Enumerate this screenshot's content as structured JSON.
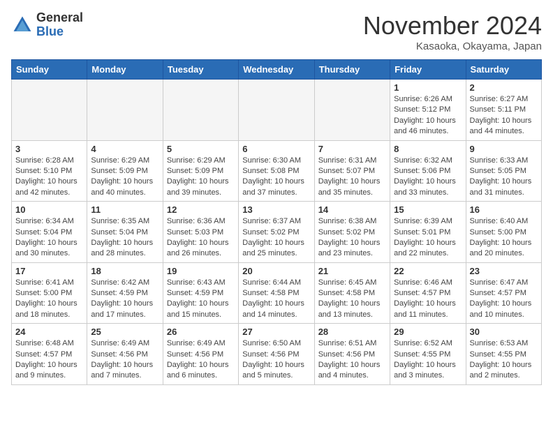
{
  "header": {
    "logo_general": "General",
    "logo_blue": "Blue",
    "month_title": "November 2024",
    "location": "Kasaoka, Okayama, Japan"
  },
  "days_of_week": [
    "Sunday",
    "Monday",
    "Tuesday",
    "Wednesday",
    "Thursday",
    "Friday",
    "Saturday"
  ],
  "weeks": [
    [
      {
        "day": "",
        "empty": true
      },
      {
        "day": "",
        "empty": true
      },
      {
        "day": "",
        "empty": true
      },
      {
        "day": "",
        "empty": true
      },
      {
        "day": "",
        "empty": true
      },
      {
        "day": "1",
        "sunrise": "6:26 AM",
        "sunset": "5:12 PM",
        "daylight": "10 hours and 46 minutes."
      },
      {
        "day": "2",
        "sunrise": "6:27 AM",
        "sunset": "5:11 PM",
        "daylight": "10 hours and 44 minutes."
      }
    ],
    [
      {
        "day": "3",
        "sunrise": "6:28 AM",
        "sunset": "5:10 PM",
        "daylight": "10 hours and 42 minutes."
      },
      {
        "day": "4",
        "sunrise": "6:29 AM",
        "sunset": "5:09 PM",
        "daylight": "10 hours and 40 minutes."
      },
      {
        "day": "5",
        "sunrise": "6:29 AM",
        "sunset": "5:09 PM",
        "daylight": "10 hours and 39 minutes."
      },
      {
        "day": "6",
        "sunrise": "6:30 AM",
        "sunset": "5:08 PM",
        "daylight": "10 hours and 37 minutes."
      },
      {
        "day": "7",
        "sunrise": "6:31 AM",
        "sunset": "5:07 PM",
        "daylight": "10 hours and 35 minutes."
      },
      {
        "day": "8",
        "sunrise": "6:32 AM",
        "sunset": "5:06 PM",
        "daylight": "10 hours and 33 minutes."
      },
      {
        "day": "9",
        "sunrise": "6:33 AM",
        "sunset": "5:05 PM",
        "daylight": "10 hours and 31 minutes."
      }
    ],
    [
      {
        "day": "10",
        "sunrise": "6:34 AM",
        "sunset": "5:04 PM",
        "daylight": "10 hours and 30 minutes."
      },
      {
        "day": "11",
        "sunrise": "6:35 AM",
        "sunset": "5:04 PM",
        "daylight": "10 hours and 28 minutes."
      },
      {
        "day": "12",
        "sunrise": "6:36 AM",
        "sunset": "5:03 PM",
        "daylight": "10 hours and 26 minutes."
      },
      {
        "day": "13",
        "sunrise": "6:37 AM",
        "sunset": "5:02 PM",
        "daylight": "10 hours and 25 minutes."
      },
      {
        "day": "14",
        "sunrise": "6:38 AM",
        "sunset": "5:02 PM",
        "daylight": "10 hours and 23 minutes."
      },
      {
        "day": "15",
        "sunrise": "6:39 AM",
        "sunset": "5:01 PM",
        "daylight": "10 hours and 22 minutes."
      },
      {
        "day": "16",
        "sunrise": "6:40 AM",
        "sunset": "5:00 PM",
        "daylight": "10 hours and 20 minutes."
      }
    ],
    [
      {
        "day": "17",
        "sunrise": "6:41 AM",
        "sunset": "5:00 PM",
        "daylight": "10 hours and 18 minutes."
      },
      {
        "day": "18",
        "sunrise": "6:42 AM",
        "sunset": "4:59 PM",
        "daylight": "10 hours and 17 minutes."
      },
      {
        "day": "19",
        "sunrise": "6:43 AM",
        "sunset": "4:59 PM",
        "daylight": "10 hours and 15 minutes."
      },
      {
        "day": "20",
        "sunrise": "6:44 AM",
        "sunset": "4:58 PM",
        "daylight": "10 hours and 14 minutes."
      },
      {
        "day": "21",
        "sunrise": "6:45 AM",
        "sunset": "4:58 PM",
        "daylight": "10 hours and 13 minutes."
      },
      {
        "day": "22",
        "sunrise": "6:46 AM",
        "sunset": "4:57 PM",
        "daylight": "10 hours and 11 minutes."
      },
      {
        "day": "23",
        "sunrise": "6:47 AM",
        "sunset": "4:57 PM",
        "daylight": "10 hours and 10 minutes."
      }
    ],
    [
      {
        "day": "24",
        "sunrise": "6:48 AM",
        "sunset": "4:57 PM",
        "daylight": "10 hours and 9 minutes."
      },
      {
        "day": "25",
        "sunrise": "6:49 AM",
        "sunset": "4:56 PM",
        "daylight": "10 hours and 7 minutes."
      },
      {
        "day": "26",
        "sunrise": "6:49 AM",
        "sunset": "4:56 PM",
        "daylight": "10 hours and 6 minutes."
      },
      {
        "day": "27",
        "sunrise": "6:50 AM",
        "sunset": "4:56 PM",
        "daylight": "10 hours and 5 minutes."
      },
      {
        "day": "28",
        "sunrise": "6:51 AM",
        "sunset": "4:56 PM",
        "daylight": "10 hours and 4 minutes."
      },
      {
        "day": "29",
        "sunrise": "6:52 AM",
        "sunset": "4:55 PM",
        "daylight": "10 hours and 3 minutes."
      },
      {
        "day": "30",
        "sunrise": "6:53 AM",
        "sunset": "4:55 PM",
        "daylight": "10 hours and 2 minutes."
      }
    ]
  ]
}
